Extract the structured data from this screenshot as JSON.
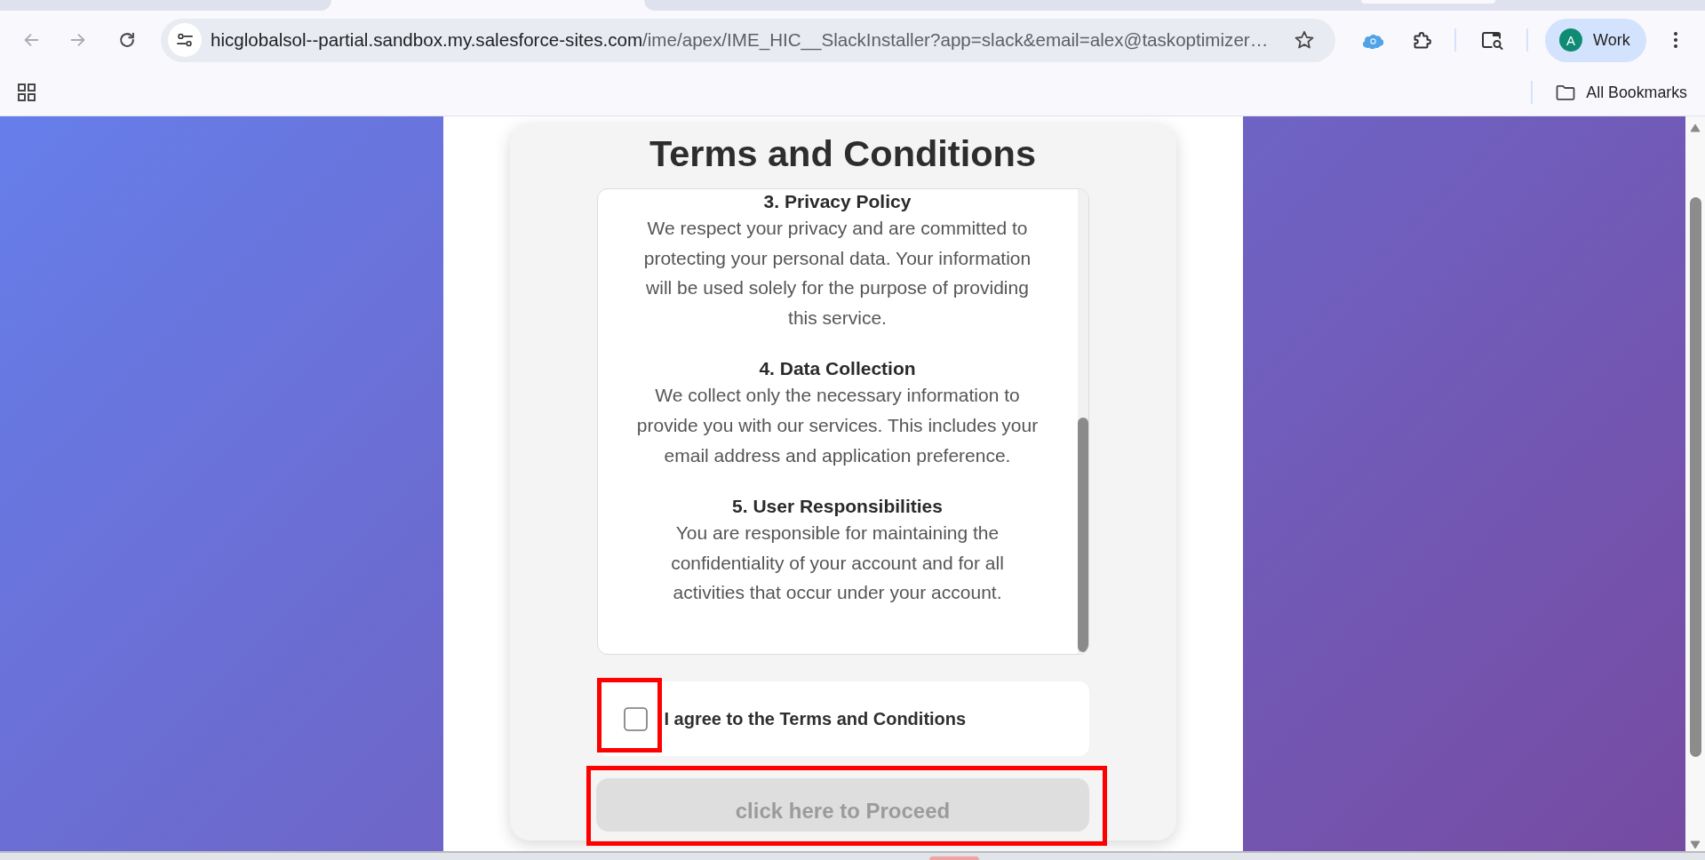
{
  "browser": {
    "navigation": {
      "back_disabled": true,
      "forward_disabled": true
    },
    "address_bar": {
      "host": "hicglobalsol--partial.sandbox.my.salesforce-sites.com",
      "path": "/ime/apex/IME_HIC__SlackInstaller?app=slack&email=alex@taskoptimizer…"
    },
    "profile": {
      "initial": "A",
      "name": "Work"
    },
    "bookmarks_bar": {
      "folder": "All Bookmarks"
    }
  },
  "page": {
    "title": "Terms and Conditions",
    "sections": [
      {
        "heading": "3. Privacy Policy",
        "body": "We respect your privacy and are committed to\nprotecting your personal data. Your information\nwill be used solely for the purpose of providing\nthis service."
      },
      {
        "heading": "4. Data Collection",
        "body": "We collect only the necessary information to\nprovide you with our services. This includes your\nemail address and application preference."
      },
      {
        "heading": "5. User Responsibilities",
        "body": "You are responsible for maintaining the\nconfidentiality of your account and for all\nactivities that occur under your account."
      }
    ],
    "agreement": {
      "label": "I agree to the Terms and Conditions",
      "checked": false,
      "highlighted": true
    },
    "proceed_button": {
      "label": "click here to Proceed",
      "disabled": true,
      "highlighted": true
    }
  }
}
